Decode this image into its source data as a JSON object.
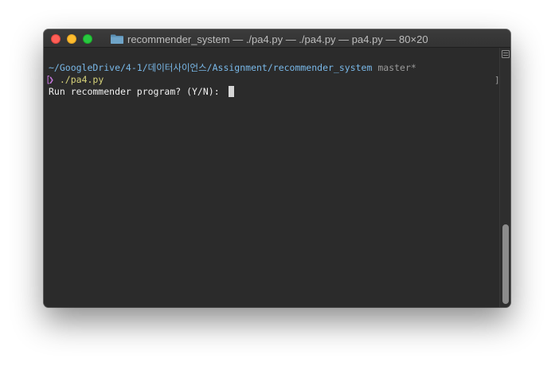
{
  "window": {
    "title": "recommender_system — ./pa4.py — ./pa4.py — pa4.py — 80×20"
  },
  "terminal": {
    "prompt_path": "~/GoogleDrive/4-1/데이터사이언스/Assignment/recommender_system",
    "prompt_branch": "master*",
    "prompt_marker": "❯",
    "left_bracket": "[",
    "command": "./pa4.py",
    "output_line": "Run recommender program? (Y/N): ",
    "right_bracket": "]"
  },
  "colors": {
    "background": "#2b2b2b",
    "path": "#79b8e8",
    "branch": "#9a9a9a",
    "prompt_marker": "#c678dd",
    "command": "#d7d37a",
    "text": "#f0f0f0"
  },
  "icons": {
    "title_icon": "folder-icon",
    "scroll_menu": "scrollbar-menu-icon"
  }
}
